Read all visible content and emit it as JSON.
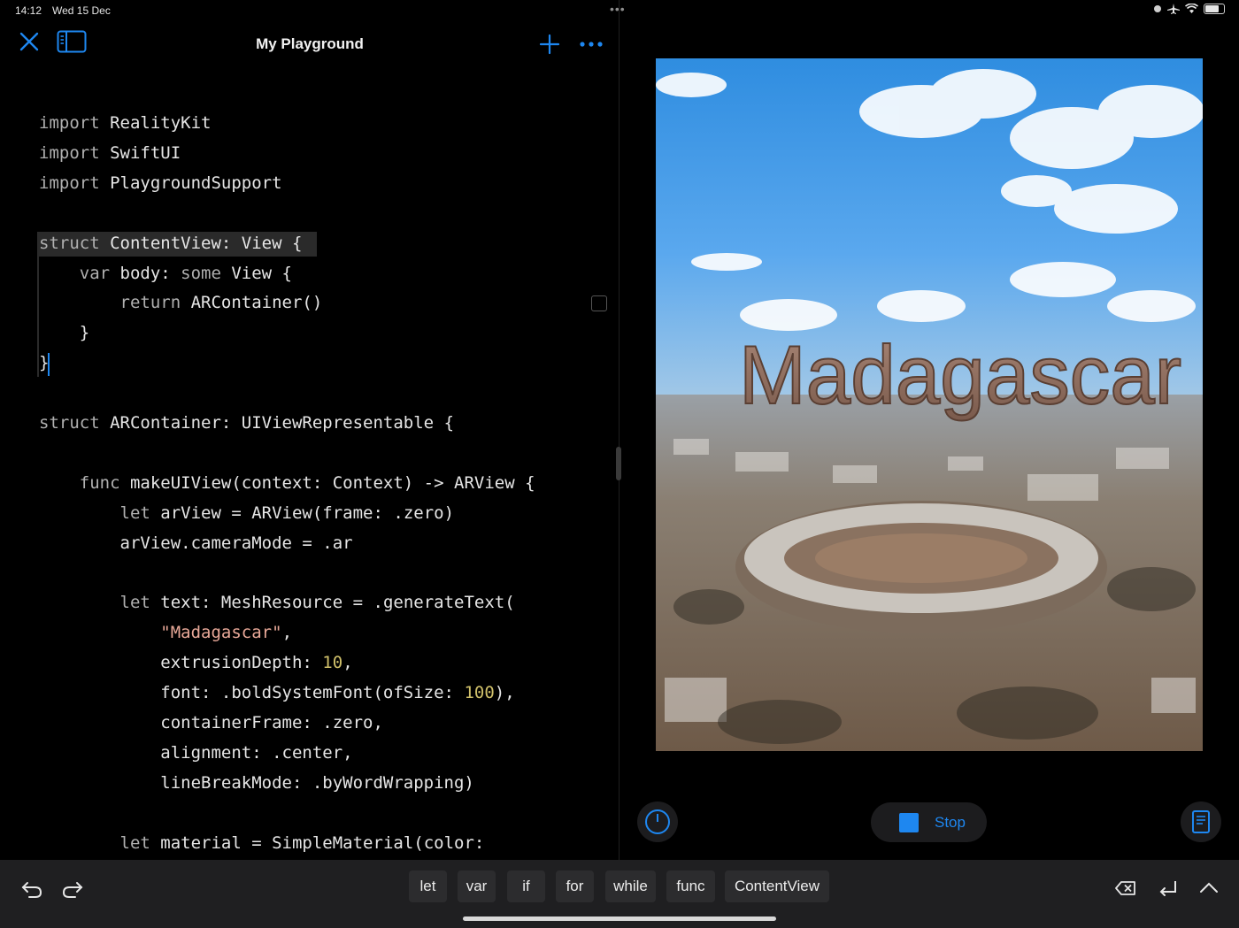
{
  "status_bar": {
    "time": "14:12",
    "date": "Wed 15 Dec",
    "center": "•••"
  },
  "toolbar": {
    "title": "My Playground"
  },
  "code": {
    "lines": [
      [
        {
          "t": "import ",
          "c": "kw"
        },
        {
          "t": "RealityKit",
          "c": ""
        }
      ],
      [
        {
          "t": "import ",
          "c": "kw"
        },
        {
          "t": "SwiftUI",
          "c": ""
        }
      ],
      [
        {
          "t": "import ",
          "c": "kw"
        },
        {
          "t": "PlaygroundSupport",
          "c": ""
        }
      ],
      [],
      [
        {
          "t": "struct ",
          "c": "kw"
        },
        {
          "t": "ContentView: View {",
          "c": ""
        }
      ],
      [
        {
          "t": "    var ",
          "c": "kw"
        },
        {
          "t": "body: ",
          "c": ""
        },
        {
          "t": "some ",
          "c": "kw"
        },
        {
          "t": "View {",
          "c": ""
        }
      ],
      [
        {
          "t": "        return ",
          "c": "kw"
        },
        {
          "t": "ARContainer()",
          "c": ""
        }
      ],
      [
        {
          "t": "    }",
          "c": ""
        }
      ],
      [
        {
          "t": "}",
          "c": ""
        }
      ],
      [],
      [
        {
          "t": "struct ",
          "c": "kw"
        },
        {
          "t": "ARContainer: UIViewRepresentable {",
          "c": ""
        }
      ],
      [],
      [
        {
          "t": "    func ",
          "c": "kw"
        },
        {
          "t": "makeUIView(context: Context) -> ARView {",
          "c": ""
        }
      ],
      [
        {
          "t": "        let ",
          "c": "kw"
        },
        {
          "t": "arView = ARView(frame: .zero)",
          "c": ""
        }
      ],
      [
        {
          "t": "        arView.cameraMode = .ar",
          "c": ""
        }
      ],
      [],
      [
        {
          "t": "        let ",
          "c": "kw"
        },
        {
          "t": "text: MeshResource = .generateText(",
          "c": ""
        }
      ],
      [
        {
          "t": "            ",
          "c": ""
        },
        {
          "t": "\"Madagascar\"",
          "c": "str"
        },
        {
          "t": ",",
          "c": ""
        }
      ],
      [
        {
          "t": "            extrusionDepth: ",
          "c": ""
        },
        {
          "t": "10",
          "c": "num"
        },
        {
          "t": ",",
          "c": ""
        }
      ],
      [
        {
          "t": "            font: .boldSystemFont(ofSize: ",
          "c": ""
        },
        {
          "t": "100",
          "c": "num"
        },
        {
          "t": "),",
          "c": ""
        }
      ],
      [
        {
          "t": "            containerFrame: .zero,",
          "c": ""
        }
      ],
      [
        {
          "t": "            alignment: .center,",
          "c": ""
        }
      ],
      [
        {
          "t": "            lineBreakMode: .byWordWrapping)",
          "c": ""
        }
      ],
      [],
      [
        {
          "t": "        let ",
          "c": "kw"
        },
        {
          "t": "material = SimpleMaterial(color:",
          "c": ""
        }
      ]
    ]
  },
  "live_view": {
    "overlay_text": "Madagascar"
  },
  "live_controls": {
    "stop_label": "Stop"
  },
  "shortcut_bar": {
    "chips": [
      "let",
      "var",
      "if",
      "for",
      "while",
      "func",
      "ContentView"
    ]
  },
  "colors": {
    "accent": "#1e87f0",
    "background": "#000000",
    "bar": "#1f1f21"
  }
}
